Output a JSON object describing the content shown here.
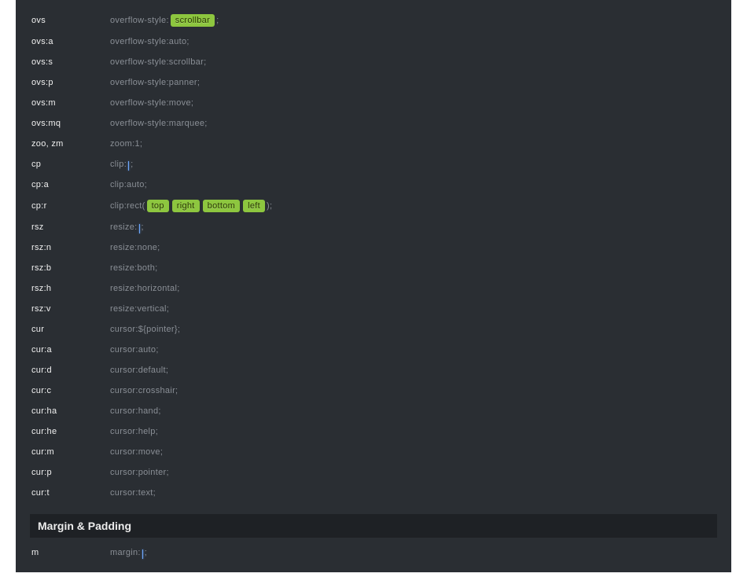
{
  "rows": [
    {
      "abbr": "ovs",
      "parts": [
        {
          "t": "text",
          "v": "overflow-style:"
        },
        {
          "t": "chip",
          "v": "scrollbar"
        },
        {
          "t": "text",
          "v": ";"
        }
      ]
    },
    {
      "abbr": "ovs:a",
      "parts": [
        {
          "t": "text",
          "v": "overflow-style:auto;"
        }
      ]
    },
    {
      "abbr": "ovs:s",
      "parts": [
        {
          "t": "text",
          "v": "overflow-style:scrollbar;"
        }
      ]
    },
    {
      "abbr": "ovs:p",
      "parts": [
        {
          "t": "text",
          "v": "overflow-style:panner;"
        }
      ]
    },
    {
      "abbr": "ovs:m",
      "parts": [
        {
          "t": "text",
          "v": "overflow-style:move;"
        }
      ]
    },
    {
      "abbr": "ovs:mq",
      "parts": [
        {
          "t": "text",
          "v": "overflow-style:marquee;"
        }
      ]
    },
    {
      "abbr": "zoo, zm",
      "parts": [
        {
          "t": "text",
          "v": "zoom:1;"
        }
      ]
    },
    {
      "abbr": "cp",
      "parts": [
        {
          "t": "text",
          "v": "clip:"
        },
        {
          "t": "caret"
        },
        {
          "t": "text",
          "v": ";"
        }
      ]
    },
    {
      "abbr": "cp:a",
      "parts": [
        {
          "t": "text",
          "v": "clip:auto;"
        }
      ]
    },
    {
      "abbr": "cp:r",
      "parts": [
        {
          "t": "text",
          "v": "clip:rect("
        },
        {
          "t": "chip",
          "v": "top"
        },
        {
          "t": "chip",
          "v": "right"
        },
        {
          "t": "chip",
          "v": "bottom"
        },
        {
          "t": "chip",
          "v": "left"
        },
        {
          "t": "text",
          "v": ");"
        }
      ]
    },
    {
      "abbr": "rsz",
      "parts": [
        {
          "t": "text",
          "v": "resize:"
        },
        {
          "t": "caret"
        },
        {
          "t": "text",
          "v": ";"
        }
      ]
    },
    {
      "abbr": "rsz:n",
      "parts": [
        {
          "t": "text",
          "v": "resize:none;"
        }
      ]
    },
    {
      "abbr": "rsz:b",
      "parts": [
        {
          "t": "text",
          "v": "resize:both;"
        }
      ]
    },
    {
      "abbr": "rsz:h",
      "parts": [
        {
          "t": "text",
          "v": "resize:horizontal;"
        }
      ]
    },
    {
      "abbr": "rsz:v",
      "parts": [
        {
          "t": "text",
          "v": "resize:vertical;"
        }
      ]
    },
    {
      "abbr": "cur",
      "parts": [
        {
          "t": "text",
          "v": "cursor:${pointer};"
        }
      ]
    },
    {
      "abbr": "cur:a",
      "parts": [
        {
          "t": "text",
          "v": "cursor:auto;"
        }
      ]
    },
    {
      "abbr": "cur:d",
      "parts": [
        {
          "t": "text",
          "v": "cursor:default;"
        }
      ]
    },
    {
      "abbr": "cur:c",
      "parts": [
        {
          "t": "text",
          "v": "cursor:crosshair;"
        }
      ]
    },
    {
      "abbr": "cur:ha",
      "parts": [
        {
          "t": "text",
          "v": "cursor:hand;"
        }
      ]
    },
    {
      "abbr": "cur:he",
      "parts": [
        {
          "t": "text",
          "v": "cursor:help;"
        }
      ]
    },
    {
      "abbr": "cur:m",
      "parts": [
        {
          "t": "text",
          "v": "cursor:move;"
        }
      ]
    },
    {
      "abbr": "cur:p",
      "parts": [
        {
          "t": "text",
          "v": "cursor:pointer;"
        }
      ]
    },
    {
      "abbr": "cur:t",
      "parts": [
        {
          "t": "text",
          "v": "cursor:text;"
        }
      ]
    }
  ],
  "section2_title": "Margin & Padding",
  "section2_rows": [
    {
      "abbr": "m",
      "parts": [
        {
          "t": "text",
          "v": "margin:"
        },
        {
          "t": "caret"
        },
        {
          "t": "text",
          "v": ";"
        }
      ]
    }
  ]
}
